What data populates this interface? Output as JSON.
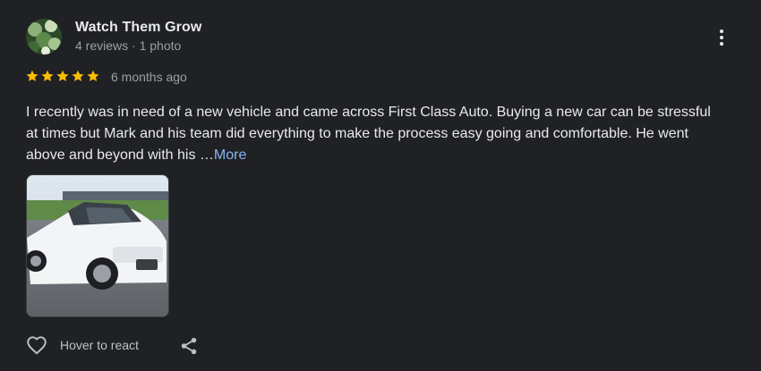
{
  "review": {
    "author_name": "Watch Them Grow",
    "author_meta": "4 reviews · 1 photo",
    "rating": 5,
    "rating_max": 5,
    "time_ago": "6 months ago",
    "text": "I recently was in need of a new vehicle and came across First Class Auto. Buying a new car can be stressful at times but Mark and his team did everything to make the process easy going and comfortable. He went above and beyond with his …",
    "more_label": "More",
    "photo_count": 1
  },
  "actions": {
    "react_label": "Hover to react"
  },
  "icons": {
    "more": "more-vert-icon",
    "star": "star-icon",
    "heart": "heart-outline-icon",
    "share": "share-icon"
  },
  "colors": {
    "background": "#202124",
    "star": "#fbbc04",
    "link": "#8ab4f8",
    "primary_text": "#e8eaed",
    "secondary_text": "#9aa0a6"
  }
}
